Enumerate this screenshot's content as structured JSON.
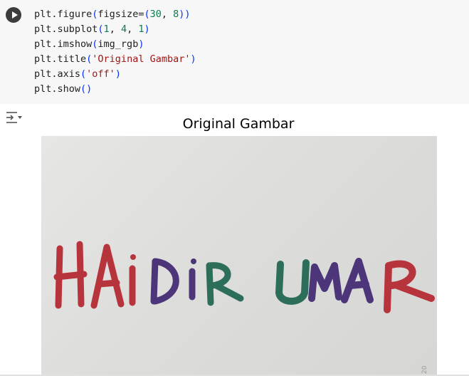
{
  "code_cell": {
    "lines": [
      [
        "plt.figure",
        "(",
        "figsize=",
        "(",
        "30",
        ", ",
        "8",
        ")",
        ")"
      ],
      [
        "plt.subplot",
        "(",
        "1",
        ", ",
        "4",
        ", ",
        "1",
        ")"
      ],
      [
        "plt.imshow",
        "(",
        "img_rgb",
        ")"
      ],
      [
        "plt.title",
        "(",
        "'Original Gambar'",
        ")"
      ],
      [
        "plt.axis",
        "(",
        "'off'",
        ")"
      ],
      [
        "plt.show",
        "(",
        ")"
      ]
    ],
    "line1": {
      "fn": "plt.figure",
      "p1": "(",
      "kw": "figsize=",
      "p2": "(",
      "a": "30",
      "sep": ", ",
      "b": "8",
      "p3": ")",
      "p4": ")"
    },
    "line2": {
      "fn": "plt.subplot",
      "p1": "(",
      "a": "1",
      "s1": ", ",
      "b": "4",
      "s2": ", ",
      "c": "1",
      "p2": ")"
    },
    "line3": {
      "fn": "plt.imshow",
      "p1": "(",
      "arg": "img_rgb",
      "p2": ")"
    },
    "line4": {
      "fn": "plt.title",
      "p1": "(",
      "arg": "'Original Gambar'",
      "p2": ")"
    },
    "line5": {
      "fn": "plt.axis",
      "p1": "(",
      "arg": "'off'",
      "p2": ")"
    },
    "line6": {
      "fn": "plt.show",
      "p1": "(",
      "p2": ")"
    }
  },
  "output": {
    "plot_title": "Original Gambar",
    "image_text": "HAIDIR UMAR",
    "image_watermark": "20"
  },
  "icons": {
    "run": "play-icon",
    "output_toggle": "output-settings-icon"
  },
  "colors": {
    "cell_bg": "#f7f7f7",
    "number": "#0b7a4d",
    "string": "#a31515",
    "paren": "#0431fa",
    "letter_red": "#b8343c",
    "letter_purple": "#4c3578",
    "letter_green": "#2d6e5b"
  }
}
